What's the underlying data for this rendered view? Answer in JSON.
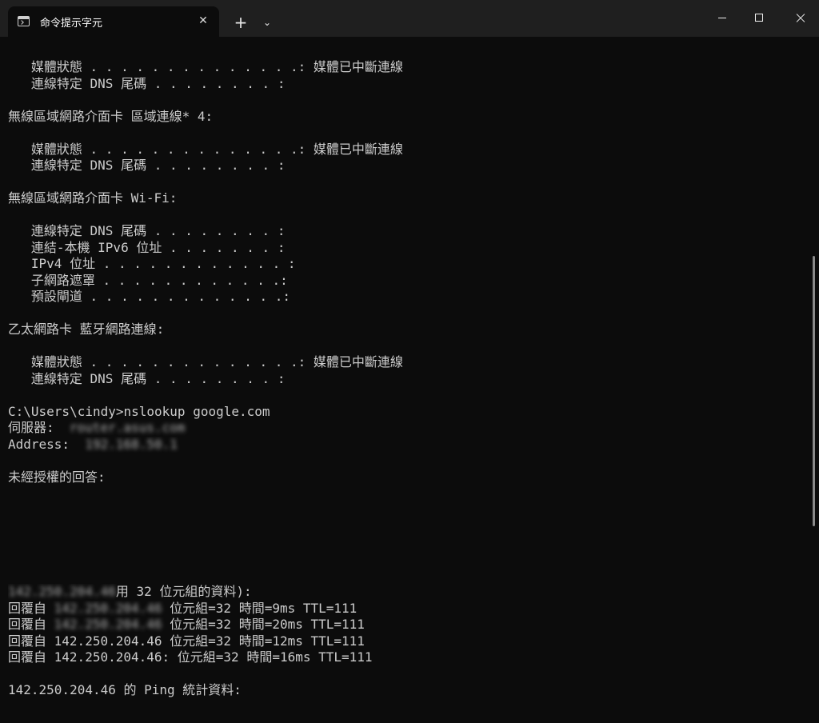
{
  "window": {
    "tab_title": "命令提示字元",
    "tab_close": "✕",
    "new_tab": "+",
    "dropdown": "⌄"
  },
  "console": {
    "lines": [
      "   媒體狀態 . . . . . . . . . . . . . .: 媒體已中斷連線",
      "   連線特定 DNS 尾碼 . . . . . . . . :",
      "",
      "無線區域網路介面卡 區域連線* 4:",
      "",
      "   媒體狀態 . . . . . . . . . . . . . .: 媒體已中斷連線",
      "   連線特定 DNS 尾碼 . . . . . . . . :",
      "",
      "無線區域網路介面卡 Wi-Fi:",
      "",
      "   連線特定 DNS 尾碼 . . . . . . . . :",
      "   連結-本機 IPv6 位址 . . . . . . . :",
      "   IPv4 位址 . . . . . . . . . . . . :",
      "   子網路遮罩 . . . . . . . . . . . .:",
      "   預設閘道 . . . . . . . . . . . . .:",
      "",
      "乙太網路卡 藍牙網路連線:",
      "",
      "   媒體狀態 . . . . . . . . . . . . . .: 媒體已中斷連線",
      "   連線特定 DNS 尾碼 . . . . . . . . :",
      "",
      "C:\\Users\\cindy>nslookup google.com",
      "伺服器:",
      "Address:",
      "",
      "未經授權的回答:",
      "",
      "",
      "",
      "",
      "",
      "",
      "",
      "",
      "",
      "",
      "",
      "",
      "142.250.204.46 的 Ping 統計資料:"
    ],
    "ping_header_tail": "用 32 位元組的資料):",
    "ping_replies": [
      {
        "prefix": "回覆自",
        "tail": "位元組=32 時間=9ms TTL=111"
      },
      {
        "prefix": "回覆自",
        "tail": "位元組=32 時間=20ms TTL=111"
      },
      {
        "prefix": "回覆自",
        "tail": "位元組=32 時間=12ms TTL=111"
      },
      {
        "prefix": "回覆自",
        "tail": "142.250.204.46: 位元組=32 時間=16ms TTL=111"
      }
    ],
    "server_blurred": "router.asus.com",
    "blurred_tokens": {
      "ipv4_a": "192.168.50.1",
      "ping_addr": "142.250.204.46"
    }
  }
}
